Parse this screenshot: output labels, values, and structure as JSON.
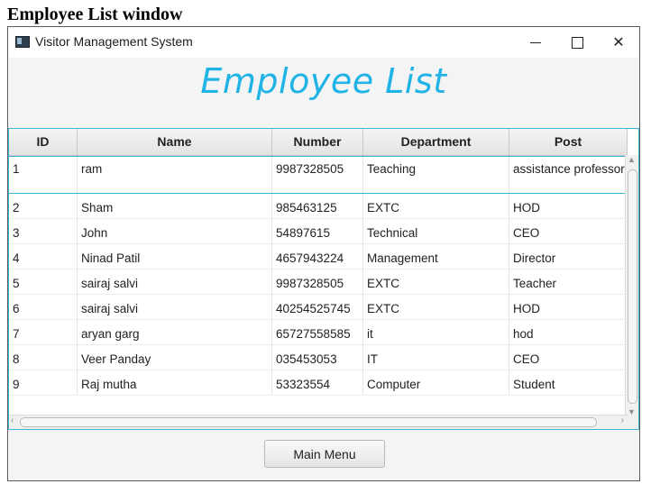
{
  "caption": "Employee List window",
  "window": {
    "title": "Visitor Management System",
    "minimize": "—",
    "maximize": "☐",
    "close": "✕"
  },
  "heading": "Employee List",
  "table": {
    "columns": [
      "ID",
      "Name",
      "Number",
      "Department",
      "Post"
    ],
    "rows": [
      [
        "1",
        "ram",
        "9987328505",
        "Teaching",
        "assistance professor"
      ],
      [
        "2",
        "Sham",
        "985463125",
        "EXTC",
        "HOD"
      ],
      [
        "3",
        "John",
        "54897615",
        "Technical",
        "CEO"
      ],
      [
        "4",
        "Ninad Patil",
        "4657943224",
        "Management",
        "Director"
      ],
      [
        "5",
        "sairaj salvi",
        "9987328505",
        "EXTC",
        "Teacher"
      ],
      [
        "6",
        "sairaj salvi",
        "40254525745",
        "EXTC",
        "HOD"
      ],
      [
        "7",
        "aryan garg",
        "65727558585",
        "it",
        "hod"
      ],
      [
        "8",
        "Veer Panday",
        "035453053",
        "IT",
        "CEO"
      ],
      [
        "9",
        "Raj mutha",
        "53323554",
        "Computer",
        "Student"
      ]
    ],
    "selected_row": 0
  },
  "main_menu_label": "Main Menu",
  "colors": {
    "heading": "#1fb3e6",
    "selection": "#3ab6d8"
  }
}
